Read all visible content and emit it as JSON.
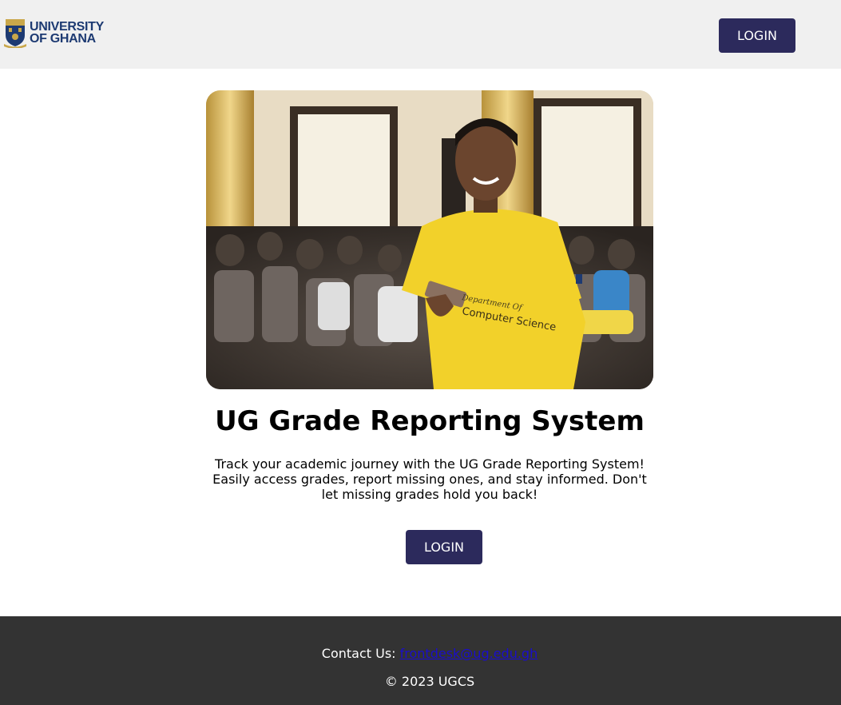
{
  "header": {
    "logo_line1": "UNIVERSITY",
    "logo_line2": "OF GHANA",
    "login_label": "LOGIN"
  },
  "hero": {
    "shirt_text_1": "Department Of",
    "shirt_text_2": "Computer Science"
  },
  "main": {
    "title": "UG Grade Reporting System",
    "description": "Track your academic journey with the UG Grade Reporting System! Easily access grades, report missing ones, and stay informed. Don't let missing grades hold you back!",
    "login_label": "LOGIN"
  },
  "footer": {
    "contact_label": "Contact Us:",
    "contact_email": "frontdesk@ug.edu.gh",
    "copyright": "© 2023 UGCS"
  },
  "colors": {
    "header_bg": "#f0f0f0",
    "button_bg": "#2c2a5c",
    "footer_bg": "#333333",
    "logo_text": "#1d3a72",
    "link": "#1a0dcc"
  }
}
